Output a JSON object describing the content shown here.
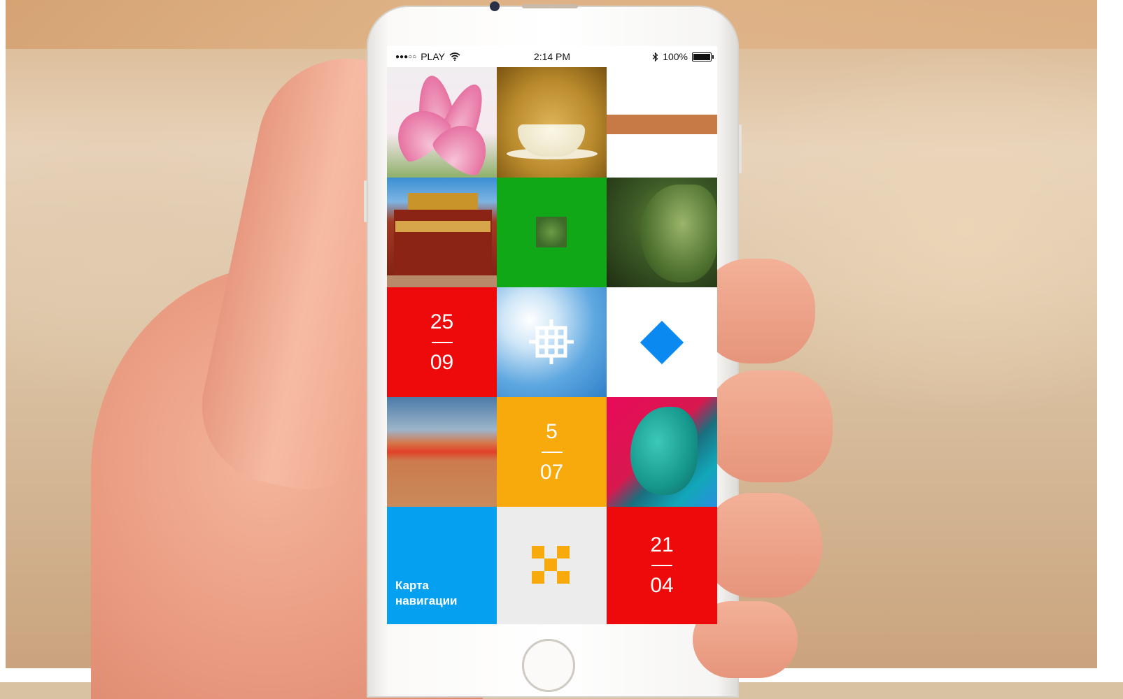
{
  "status_bar": {
    "carrier": "PLAY",
    "time": "2:14 PM",
    "battery": "100%",
    "signal_icon": "signal-dots-icon",
    "wifi_icon": "wifi-icon",
    "bluetooth_icon": "bluetooth-icon",
    "battery_icon": "battery-icon"
  },
  "tiles": [
    {
      "kind": "photo",
      "subject": "lotus"
    },
    {
      "kind": "photo",
      "subject": "tea-bowl"
    },
    {
      "kind": "photo",
      "subject": "desert-strip"
    },
    {
      "kind": "photo",
      "subject": "temple"
    },
    {
      "kind": "icon",
      "color": "#10a816",
      "icon": "ornament-icon"
    },
    {
      "kind": "photo",
      "subject": "buddha"
    },
    {
      "kind": "date",
      "color": "#ee0a0a",
      "day": "25",
      "month": "09"
    },
    {
      "kind": "icon",
      "icon": "endless-knot-icon"
    },
    {
      "kind": "icon",
      "color": "#ffffff",
      "icon": "diamond-icon"
    },
    {
      "kind": "photo",
      "subject": "desert"
    },
    {
      "kind": "date",
      "color": "#f8aa0c",
      "day": "5",
      "month": "07"
    },
    {
      "kind": "photo",
      "subject": "feather"
    },
    {
      "kind": "nav",
      "color": "#06a0f0",
      "label_line1": "Карта",
      "label_line2": "навигации"
    },
    {
      "kind": "icon",
      "color": "#ececec",
      "icon": "checker-icon"
    },
    {
      "kind": "date",
      "color": "#ee0a0a",
      "day": "21",
      "month": "04"
    }
  ]
}
